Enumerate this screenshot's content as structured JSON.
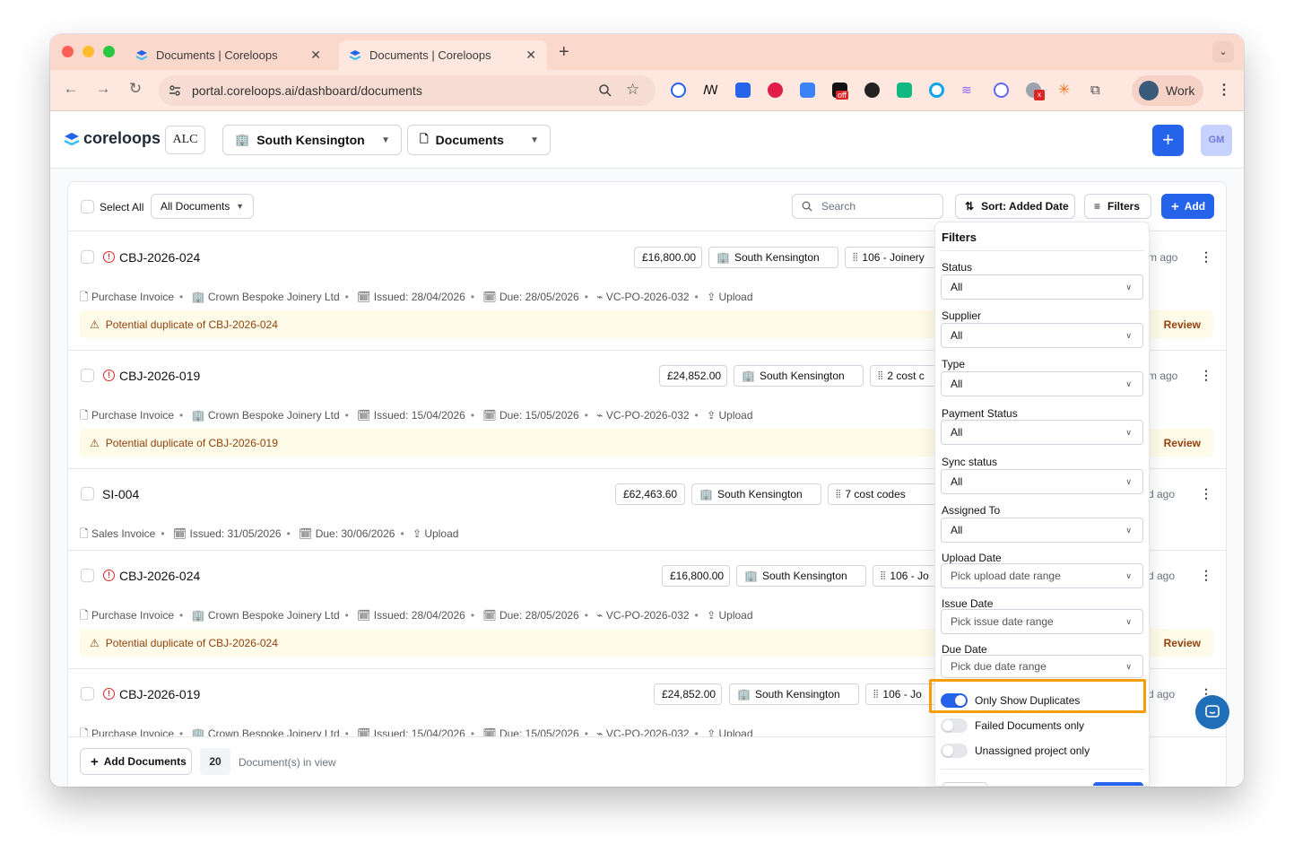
{
  "browser": {
    "tabs": [
      {
        "title": "Documents | Coreloops",
        "active": false
      },
      {
        "title": "Documents | Coreloops",
        "active": true
      }
    ],
    "url": "portal.coreloops.ai/dashboard/documents",
    "profile_label": "Work",
    "extension_badge": "off"
  },
  "header": {
    "logo_text": "coreloops",
    "org_badge": "ALC",
    "project_select": "South Kensington",
    "section_select": "Documents",
    "user_initials": "GM"
  },
  "list": {
    "select_all_label": "Select All",
    "filter_dropdown": "All Documents",
    "search_placeholder": "Search",
    "sort_label": "Sort: Added Date",
    "filters_label": "Filters",
    "add_label": "Add",
    "rows": [
      {
        "id": "CBJ-2026-024",
        "amount": "£16,800.00",
        "location": "South Kensington",
        "cost": "106 - Joinery",
        "ago": "m ago",
        "type": "Purchase Invoice",
        "supplier": "Crown Bespoke Joinery Ltd",
        "issued": "Issued: 28/04/2026",
        "due": "Due: 28/05/2026",
        "po": "VC-PO-2026-032",
        "source": "Upload",
        "duplicate": "Potential duplicate of CBJ-2026-024",
        "review": "Review"
      },
      {
        "id": "CBJ-2026-019",
        "amount": "£24,852.00",
        "location": "South Kensington",
        "cost": "2 cost c",
        "ago": "m ago",
        "type": "Purchase Invoice",
        "supplier": "Crown Bespoke Joinery Ltd",
        "issued": "Issued: 15/04/2026",
        "due": "Due: 15/05/2026",
        "po": "VC-PO-2026-032",
        "source": "Upload",
        "duplicate": "Potential duplicate of CBJ-2026-019",
        "review": "Review"
      },
      {
        "id": "SI-004",
        "amount": "£62,463.60",
        "location": "South Kensington",
        "cost": "7 cost codes",
        "ago": "d ago",
        "type": "Sales Invoice",
        "issued": "Issued: 31/05/2026",
        "due": "Due: 30/06/2026",
        "source": "Upload"
      },
      {
        "id": "CBJ-2026-024",
        "amount": "£16,800.00",
        "location": "South Kensington",
        "cost": "106 - Jo",
        "ago": "d ago",
        "type": "Purchase Invoice",
        "supplier": "Crown Bespoke Joinery Ltd",
        "issued": "Issued: 28/04/2026",
        "due": "Due: 28/05/2026",
        "po": "VC-PO-2026-032",
        "source": "Upload",
        "duplicate": "Potential duplicate of CBJ-2026-024",
        "review": "Review"
      },
      {
        "id": "CBJ-2026-019",
        "amount": "£24,852.00",
        "location": "South Kensington",
        "cost": "106 - Jo",
        "ago": "d ago",
        "type": "Purchase Invoice",
        "supplier": "Crown Bespoke Joinery Ltd",
        "issued": "Issued: 15/04/2026",
        "due": "Due: 15/05/2026",
        "po": "VC-PO-2026-032",
        "source": "Upload"
      }
    ],
    "add_documents_label": "Add Documents",
    "count": "20",
    "count_label": "Document(s) in view"
  },
  "filters": {
    "title": "Filters",
    "fields": [
      {
        "label": "Status",
        "value": "All"
      },
      {
        "label": "Supplier",
        "value": "All"
      },
      {
        "label": "Type",
        "value": "All"
      },
      {
        "label": "Payment Status",
        "value": "All"
      },
      {
        "label": "Sync status",
        "value": "All"
      },
      {
        "label": "Assigned To",
        "value": "All"
      },
      {
        "label": "Upload Date",
        "value": "Pick upload date range"
      },
      {
        "label": "Issue Date",
        "value": "Pick issue date range"
      },
      {
        "label": "Due Date",
        "value": "Pick due date range"
      }
    ],
    "toggles": [
      {
        "label": "Only Show Duplicates",
        "on": true
      },
      {
        "label": "Failed Documents only",
        "on": false
      },
      {
        "label": "Unassigned project only",
        "on": false
      }
    ]
  },
  "colors": {
    "accent": "#2563eb",
    "highlight": "#f59e0b",
    "warning_bg": "#fefce8",
    "warning_text": "#92400e",
    "error": "#dc2626"
  }
}
